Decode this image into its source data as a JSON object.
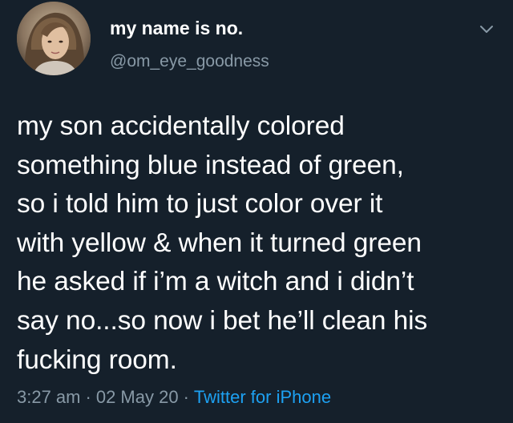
{
  "user": {
    "display_name": "my name is no.",
    "handle": "@om_eye_goodness"
  },
  "tweet": {
    "lines": [
      "my son accidentally colored",
      "something blue instead of green,",
      "so i told him to just color over it",
      "with yellow & when it turned green",
      "he asked if i’m a witch and i didn’t",
      "say no...so now i bet he’ll clean his",
      "fucking room."
    ]
  },
  "meta": {
    "time": "3:27 am",
    "separator": "·",
    "date": "02 May 20",
    "source": "Twitter for iPhone"
  },
  "icons": {
    "menu": "chevron-down-icon"
  },
  "colors": {
    "background": "#15202b",
    "text": "#ffffff",
    "secondary": "#8899a6",
    "link": "#1da1f2"
  }
}
